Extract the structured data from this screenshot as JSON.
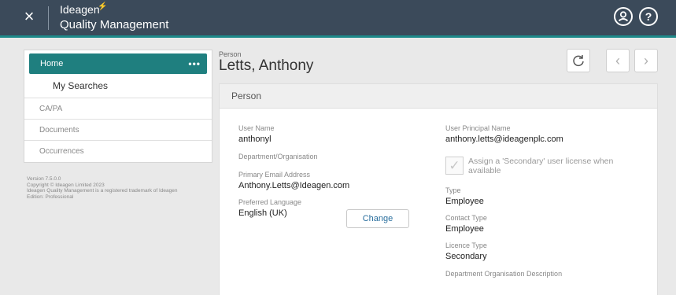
{
  "header": {
    "close_icon": "×",
    "brand_name": "Ideagen",
    "brand_product": "Quality Management",
    "user_icon": "user-icon",
    "help_icon": "?",
    "colors": {
      "bar": "#3b4a5a",
      "accent": "#1e8a8a"
    }
  },
  "sidebar": {
    "home_label": "Home",
    "home_menu": "•••",
    "sub_items": [
      "My Searches"
    ],
    "items": [
      "CA/PA",
      "Documents",
      "Occurrences"
    ],
    "footer": {
      "version": "Version 7.5.0.0",
      "copyright": "Copyright © Ideagen Limited 2023",
      "trademark": "Ideagen Quality Management is a registered trademark of Ideagen",
      "edition": "Edition: Professional"
    }
  },
  "page": {
    "entity_type": "Person",
    "title": "Letts, Anthony",
    "refresh_icon": "↻",
    "prev_icon": "‹",
    "next_icon": "›"
  },
  "panel": {
    "header": "Person",
    "left": {
      "user_name_label": "User Name",
      "user_name_value": "anthonyl",
      "department_label": "Department/Organisation",
      "email_label": "Primary Email Address",
      "email_value": "Anthony.Letts@Ideagen.com",
      "language_label": "Preferred Language",
      "language_value": "English (UK)",
      "change_button": "Change"
    },
    "right": {
      "upn_label": "User Principal Name",
      "upn_value": "anthony.letts@ideagenplc.com",
      "secondary_checkbox_label": "Assign a 'Secondary' user license when available",
      "checkbox_mark": "✓",
      "type_label": "Type",
      "type_value": "Employee",
      "contact_type_label": "Contact Type",
      "contact_type_value": "Employee",
      "licence_type_label": "Licence Type",
      "licence_type_value": "Secondary",
      "dept_org_desc_label": "Department Organisation Description"
    }
  }
}
